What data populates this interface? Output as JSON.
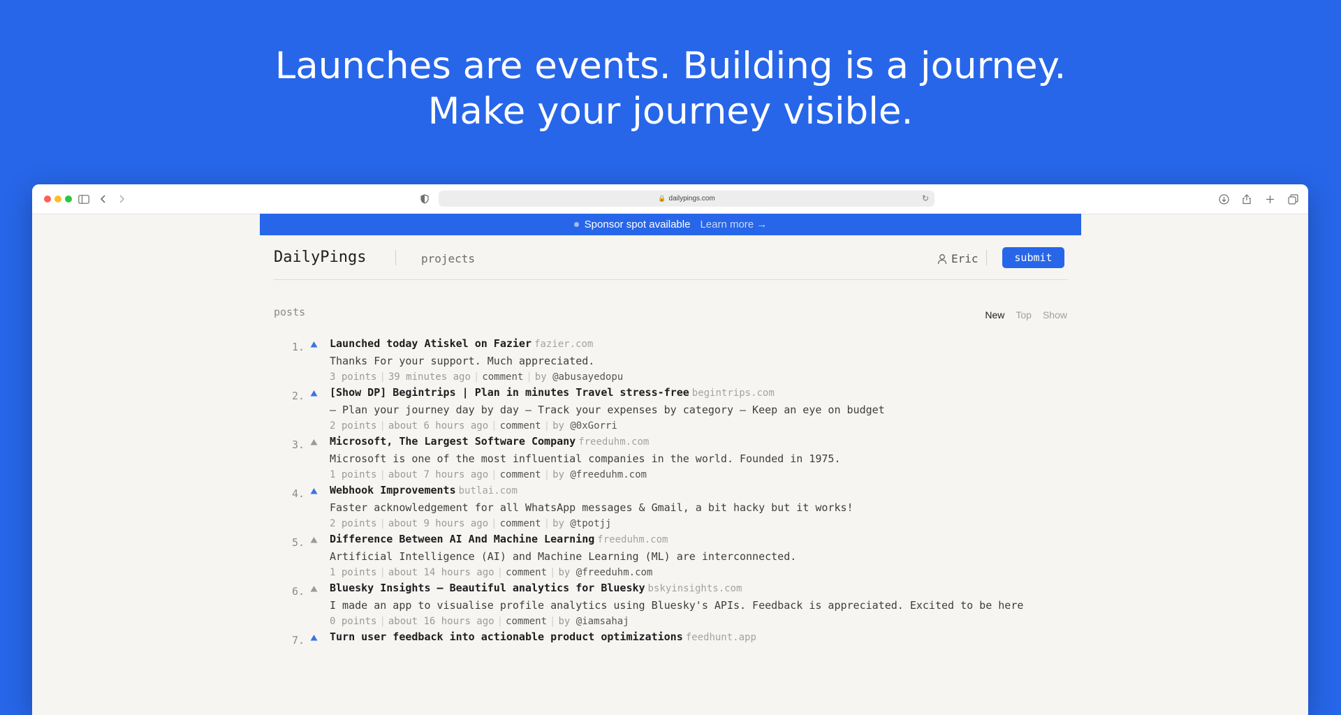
{
  "hero": {
    "line1": "Launches are events. Building is a journey.",
    "line2": "Make your journey visible."
  },
  "browser": {
    "url": "dailypings.com",
    "icons": [
      "close-dot",
      "minimize-dot",
      "maximize-dot",
      "sidebar-icon",
      "back-icon",
      "forward-icon",
      "shield-icon",
      "lock-icon",
      "reload-icon",
      "download-icon",
      "share-icon",
      "new-tab-icon",
      "tabs-icon"
    ]
  },
  "sponsor": {
    "text": "Sponsor spot available",
    "link": "Learn more →"
  },
  "nav": {
    "brand": "DailyPings",
    "projects": "projects",
    "user": "Eric",
    "submit": "submit"
  },
  "posts_label": "posts",
  "sort_tabs": [
    "New",
    "Top",
    "Show"
  ],
  "posts": [
    {
      "rank": "1.",
      "title": "Launched today Atiskel on Fazier",
      "domain": "fazier.com",
      "desc": "Thanks For your support. Much appreciated.",
      "points": "3 points",
      "time": "39 minutes ago",
      "comment": "comment",
      "by": "by",
      "user": "@abusayedopu",
      "voted": true
    },
    {
      "rank": "2.",
      "title": "[Show DP] Begintrips | Plan in minutes Travel stress-free",
      "domain": "begintrips.com",
      "desc": "– Plan your journey day by day – Track your expenses by category – Keep an eye on budget",
      "points": "2 points",
      "time": "about 6 hours ago",
      "comment": "comment",
      "by": "by",
      "user": "@0xGorri",
      "voted": true
    },
    {
      "rank": "3.",
      "title": "Microsoft, The Largest Software Company",
      "domain": "freeduhm.com",
      "desc": "Microsoft is one of the most influential companies in the world. Founded in 1975.",
      "points": "1 points",
      "time": "about 7 hours ago",
      "comment": "comment",
      "by": "by",
      "user": "@freeduhm.com",
      "voted": false
    },
    {
      "rank": "4.",
      "title": "Webhook Improvements",
      "domain": "butlai.com",
      "desc": "Faster acknowledgement for all WhatsApp messages & Gmail, a bit hacky but it works!",
      "points": "2 points",
      "time": "about 9 hours ago",
      "comment": "comment",
      "by": "by",
      "user": "@tpotjj",
      "voted": true
    },
    {
      "rank": "5.",
      "title": "Difference Between AI And Machine Learning",
      "domain": "freeduhm.com",
      "desc": "Artificial Intelligence (AI) and Machine Learning (ML) are interconnected.",
      "points": "1 points",
      "time": "about 14 hours ago",
      "comment": "comment",
      "by": "by",
      "user": "@freeduhm.com",
      "voted": false
    },
    {
      "rank": "6.",
      "title": "Bluesky Insights – Beautiful analytics for Bluesky",
      "domain": "bskyinsights.com",
      "desc": "I made an app to visualise profile analytics using Bluesky's APIs. Feedback is appreciated. Excited to be here",
      "points": "0 points",
      "time": "about 16 hours ago",
      "comment": "comment",
      "by": "by",
      "user": "@iamsahaj",
      "voted": false
    },
    {
      "rank": "7.",
      "title": "Turn user feedback into actionable product optimizations",
      "domain": "feedhunt.app",
      "desc": "",
      "points": "",
      "time": "",
      "comment": "",
      "by": "",
      "user": "",
      "voted": true
    }
  ],
  "colors": {
    "brand_blue": "#2766e9",
    "page_bg": "#f6f5f1",
    "vote_active": "#3b73e6",
    "vote_inactive": "#9a9a9a"
  }
}
